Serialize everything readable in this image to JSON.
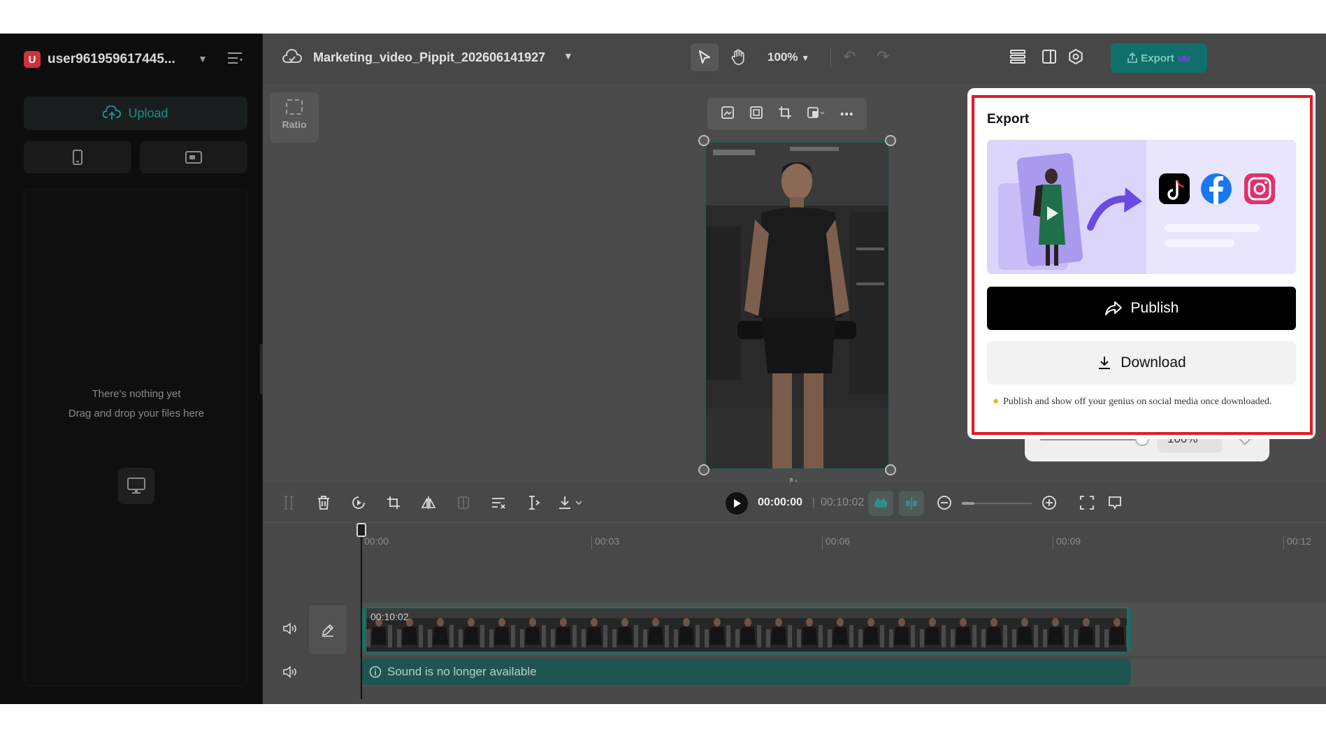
{
  "sidebar": {
    "avatar_letter": "U",
    "username": "user961959617445...",
    "upload_label": "Upload",
    "empty_line1": "There's nothing yet",
    "empty_line2": "Drag and drop your files here"
  },
  "topbar": {
    "project_name": "Marketing_video_Pippit_202606141927",
    "zoom": "100%",
    "export_label": "Export"
  },
  "canvas": {
    "ratio_label": "Ratio"
  },
  "export_panel": {
    "title": "Export",
    "publish_label": "Publish",
    "download_label": "Download",
    "tip": "Publish and show off your genius on social media once downloaded.",
    "zoom_value": "100%"
  },
  "timeline": {
    "current_time": "00:00:00",
    "separator": "|",
    "total_time": "00:10:02",
    "ticks": [
      "00:00",
      "00:03",
      "00:06",
      "00:09",
      "00:12"
    ],
    "clip_duration": "00:10:02",
    "sound_message": "Sound is no longer available"
  },
  "colors": {
    "accent": "#0f6f6a",
    "highlight": "#e01b24",
    "banner": "#dcd5fb"
  }
}
